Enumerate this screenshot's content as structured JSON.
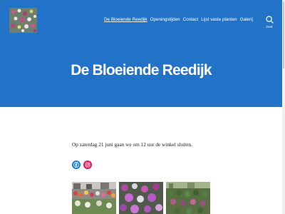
{
  "header": {
    "nav_items": [
      {
        "label": "De Bloeiende Reedijk",
        "active": true
      },
      {
        "label": "Openingstijden",
        "active": false
      },
      {
        "label": "Contact",
        "active": false
      },
      {
        "label": "Lijst vaste planten",
        "active": false
      },
      {
        "label": "Galerij",
        "active": false
      }
    ],
    "search_label": "Zoek",
    "background_color": "#2273c8"
  },
  "hero": {
    "title": "De Bloeiende Reedijk"
  },
  "content": {
    "notice": "Op zaterdag 21 juni gaan we om 12 uur de winkel sluiten."
  },
  "social": [
    {
      "icon": "facebook-icon",
      "color": "#1877f2"
    },
    {
      "icon": "instagram-icon",
      "color": "#e4175c"
    }
  ],
  "gallery": [
    {
      "icon": "flower-market-photo"
    },
    {
      "icon": "purple-flowers-photo"
    },
    {
      "icon": "potted-plants-photo"
    }
  ]
}
